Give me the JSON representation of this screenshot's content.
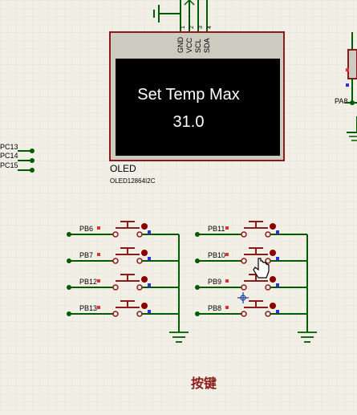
{
  "oled": {
    "pins": [
      "GND",
      "VCC",
      "SCL",
      "SDA"
    ],
    "pin_numbers": [
      "1",
      "2",
      "3",
      "4"
    ],
    "line1": "Set Temp Max",
    "line2": "31.0",
    "label": "OLED",
    "part": "OLED12864I2C"
  },
  "left_labels": [
    "PC13",
    "PC14",
    "PC15"
  ],
  "right_label": "PA8",
  "buttons_left": [
    "PB6",
    "PB7",
    "PB12",
    "PB13"
  ],
  "buttons_right": [
    "PB11",
    "PB10",
    "PB9",
    "PB8"
  ],
  "section_title": "按键",
  "colors": {
    "wire": "#005a00",
    "component": "#8b1a1a",
    "screen": "#000000",
    "text_screen": "#ffffff",
    "title": "#8b1a1a"
  },
  "icons": [
    "hand-cursor-icon",
    "crosshair-icon",
    "ground-icon"
  ]
}
